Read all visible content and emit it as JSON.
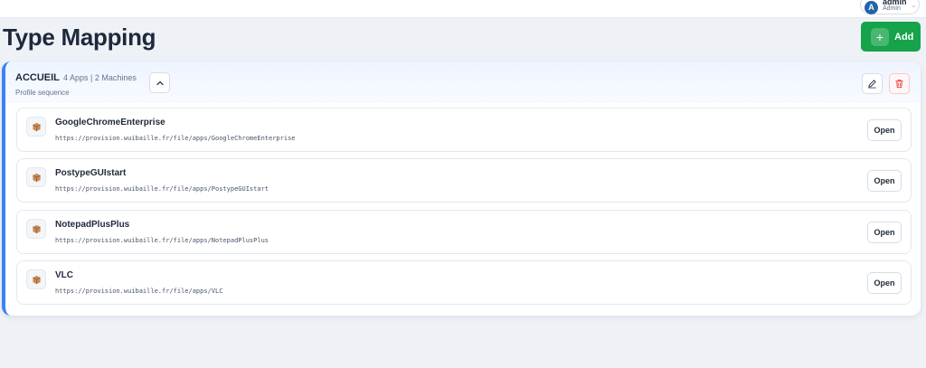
{
  "user": {
    "initial": "A",
    "name": "admin",
    "role": "Admin"
  },
  "page": {
    "title": "Type Mapping",
    "add_label": "Add"
  },
  "group": {
    "name": "ACCUEIL",
    "meta": "4 Apps | 2 Machines",
    "subtitle": "Profile sequence",
    "apps": [
      {
        "name": "GoogleChromeEnterprise",
        "url": "https://provision.wuibaille.fr/file/apps/GoogleChromeEnterprise",
        "open_label": "Open"
      },
      {
        "name": "PostypeGUIstart",
        "url": "https://provision.wuibaille.fr/file/apps/PostypeGUIstart",
        "open_label": "Open"
      },
      {
        "name": "NotepadPlusPlus",
        "url": "https://provision.wuibaille.fr/file/apps/NotepadPlusPlus",
        "open_label": "Open"
      },
      {
        "name": "VLC",
        "url": "https://provision.wuibaille.fr/file/apps/VLC",
        "open_label": "Open"
      }
    ]
  },
  "icons": {
    "avatar": "avatar",
    "caret": "chevron-down-icon",
    "add": "plus-icon",
    "collapse": "chevron-up-icon",
    "edit": "pencil-icon",
    "delete": "trash-icon",
    "app": "package-icon"
  },
  "colors": {
    "accent": "#3b82f6",
    "add_button": "#16a34a",
    "delete": "#ef4444",
    "avatar": "#2563a8"
  }
}
